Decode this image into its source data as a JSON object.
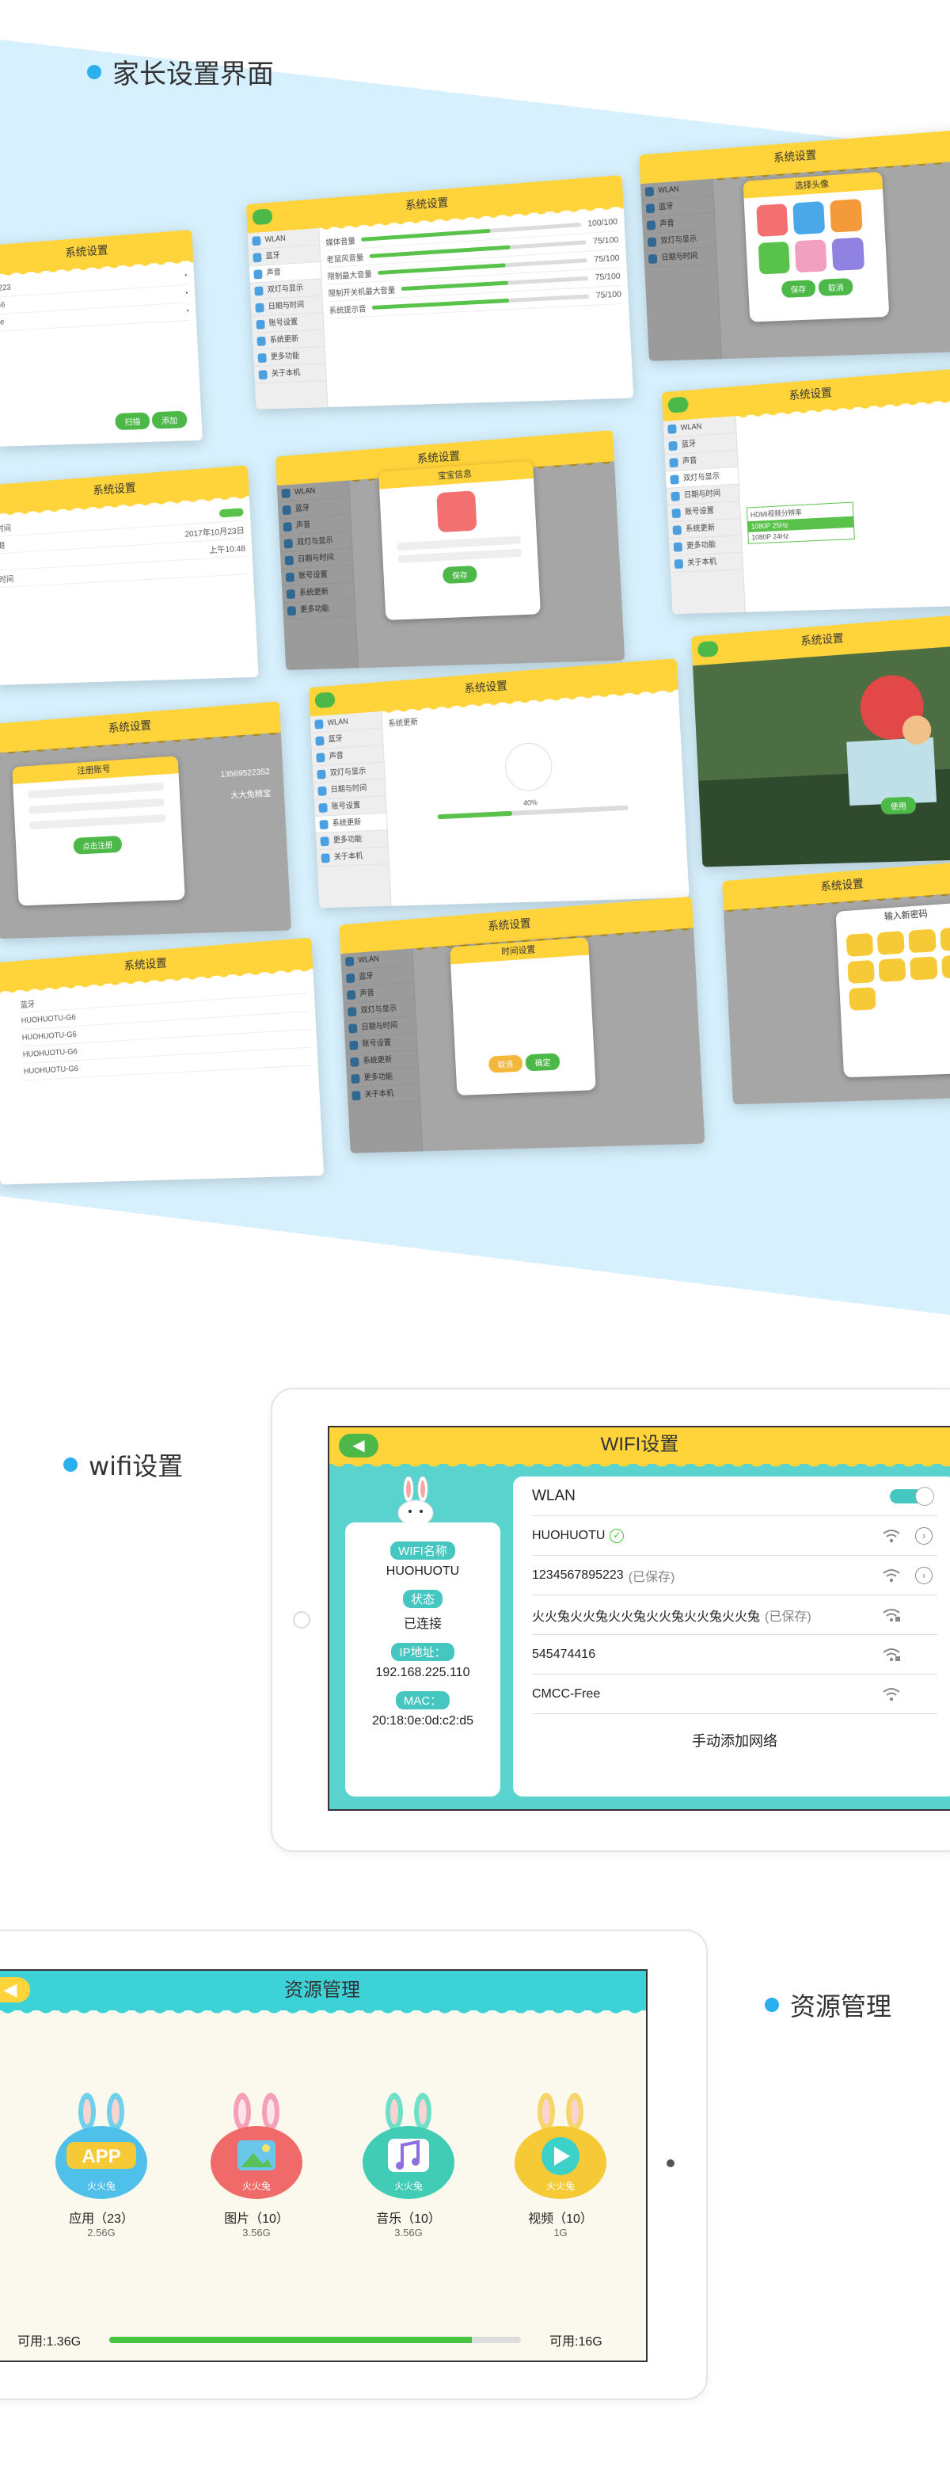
{
  "section1": {
    "title": "家长设置界面",
    "screens": {
      "system_settings": "系统设置",
      "sidebar": [
        "WLAN",
        "蓝牙",
        "声音",
        "双灯与显示",
        "日期与时间",
        "账号设置",
        "系统更新",
        "更多功能",
        "关于本机"
      ],
      "sound_rows": [
        {
          "label": "媒体音量",
          "value": "100/100"
        },
        {
          "label": "老鼠风音量",
          "value": "75/100"
        },
        {
          "label": "限制最大音量",
          "value": "75/100"
        },
        {
          "label": "限制开关机最大音量",
          "value": "75/100"
        },
        {
          "label": "系统提示音",
          "value": "75/100"
        }
      ],
      "avatar_title": "选择头像",
      "avatar_save": "保存",
      "avatar_cancel": "取消",
      "baby_info": "宝宝信息",
      "baby_save": "保存",
      "register": "注册账号",
      "register_btn": "点击注册",
      "date_row": "2017年10月23日",
      "time_row": "上午10:48",
      "time_dialog": "时间设置",
      "time_cancel": "取消",
      "time_ok": "确定",
      "update_title": "系统更新",
      "update_progress": "40%",
      "use_btn": "使用",
      "password_title": "输入新密码",
      "hdmi_options": [
        "HDMI视频分辨率",
        "1080P 25Hz",
        "1080P 24Hz"
      ],
      "bluetooth_device": "HUOHUOTU-G6",
      "account_id": "13569522352",
      "account_name": "大大兔精宝",
      "wifi_btns": [
        "扫描",
        "添加"
      ]
    }
  },
  "wifi": {
    "section_title": "wifi设置",
    "header": "WIFI设置",
    "info": {
      "name_label": "WIFI名称",
      "name": "HUOHUOTU",
      "status_label": "状态",
      "status": "已连接",
      "ip_label": "IP地址：",
      "ip": "192.168.225.110",
      "mac_label": "MAC：",
      "mac": "20:18:0e:0d:c2:d5"
    },
    "wlan_label": "WLAN",
    "networks": [
      {
        "name": "HUOHUOTU",
        "note": ""
      },
      {
        "name": "1234567895223",
        "note": "(已保存)"
      },
      {
        "name": "火火兔火火兔火火兔火火兔火火兔火火兔",
        "note": "(已保存)"
      },
      {
        "name": "545474416",
        "note": ""
      },
      {
        "name": "CMCC-Free",
        "note": ""
      }
    ],
    "manual_add": "手动添加网络"
  },
  "resources": {
    "section_title": "资源管理",
    "header": "资源管理",
    "items": [
      {
        "name": "应用（23）",
        "size": "2.56G",
        "badge": "APP",
        "color": "#f6c936"
      },
      {
        "name": "图片（10）",
        "size": "3.56G",
        "badge": "",
        "color": "#f06a6a"
      },
      {
        "name": "音乐（10）",
        "size": "3.56G",
        "badge": "",
        "color": "#41cdb5"
      },
      {
        "name": "视频（10）",
        "size": "1G",
        "badge": "",
        "color": "#f6c936"
      }
    ],
    "brand": "火火兔",
    "available_left": "可用:1.36G",
    "available_right": "可用:16G",
    "usage_fraction": 0.88
  }
}
